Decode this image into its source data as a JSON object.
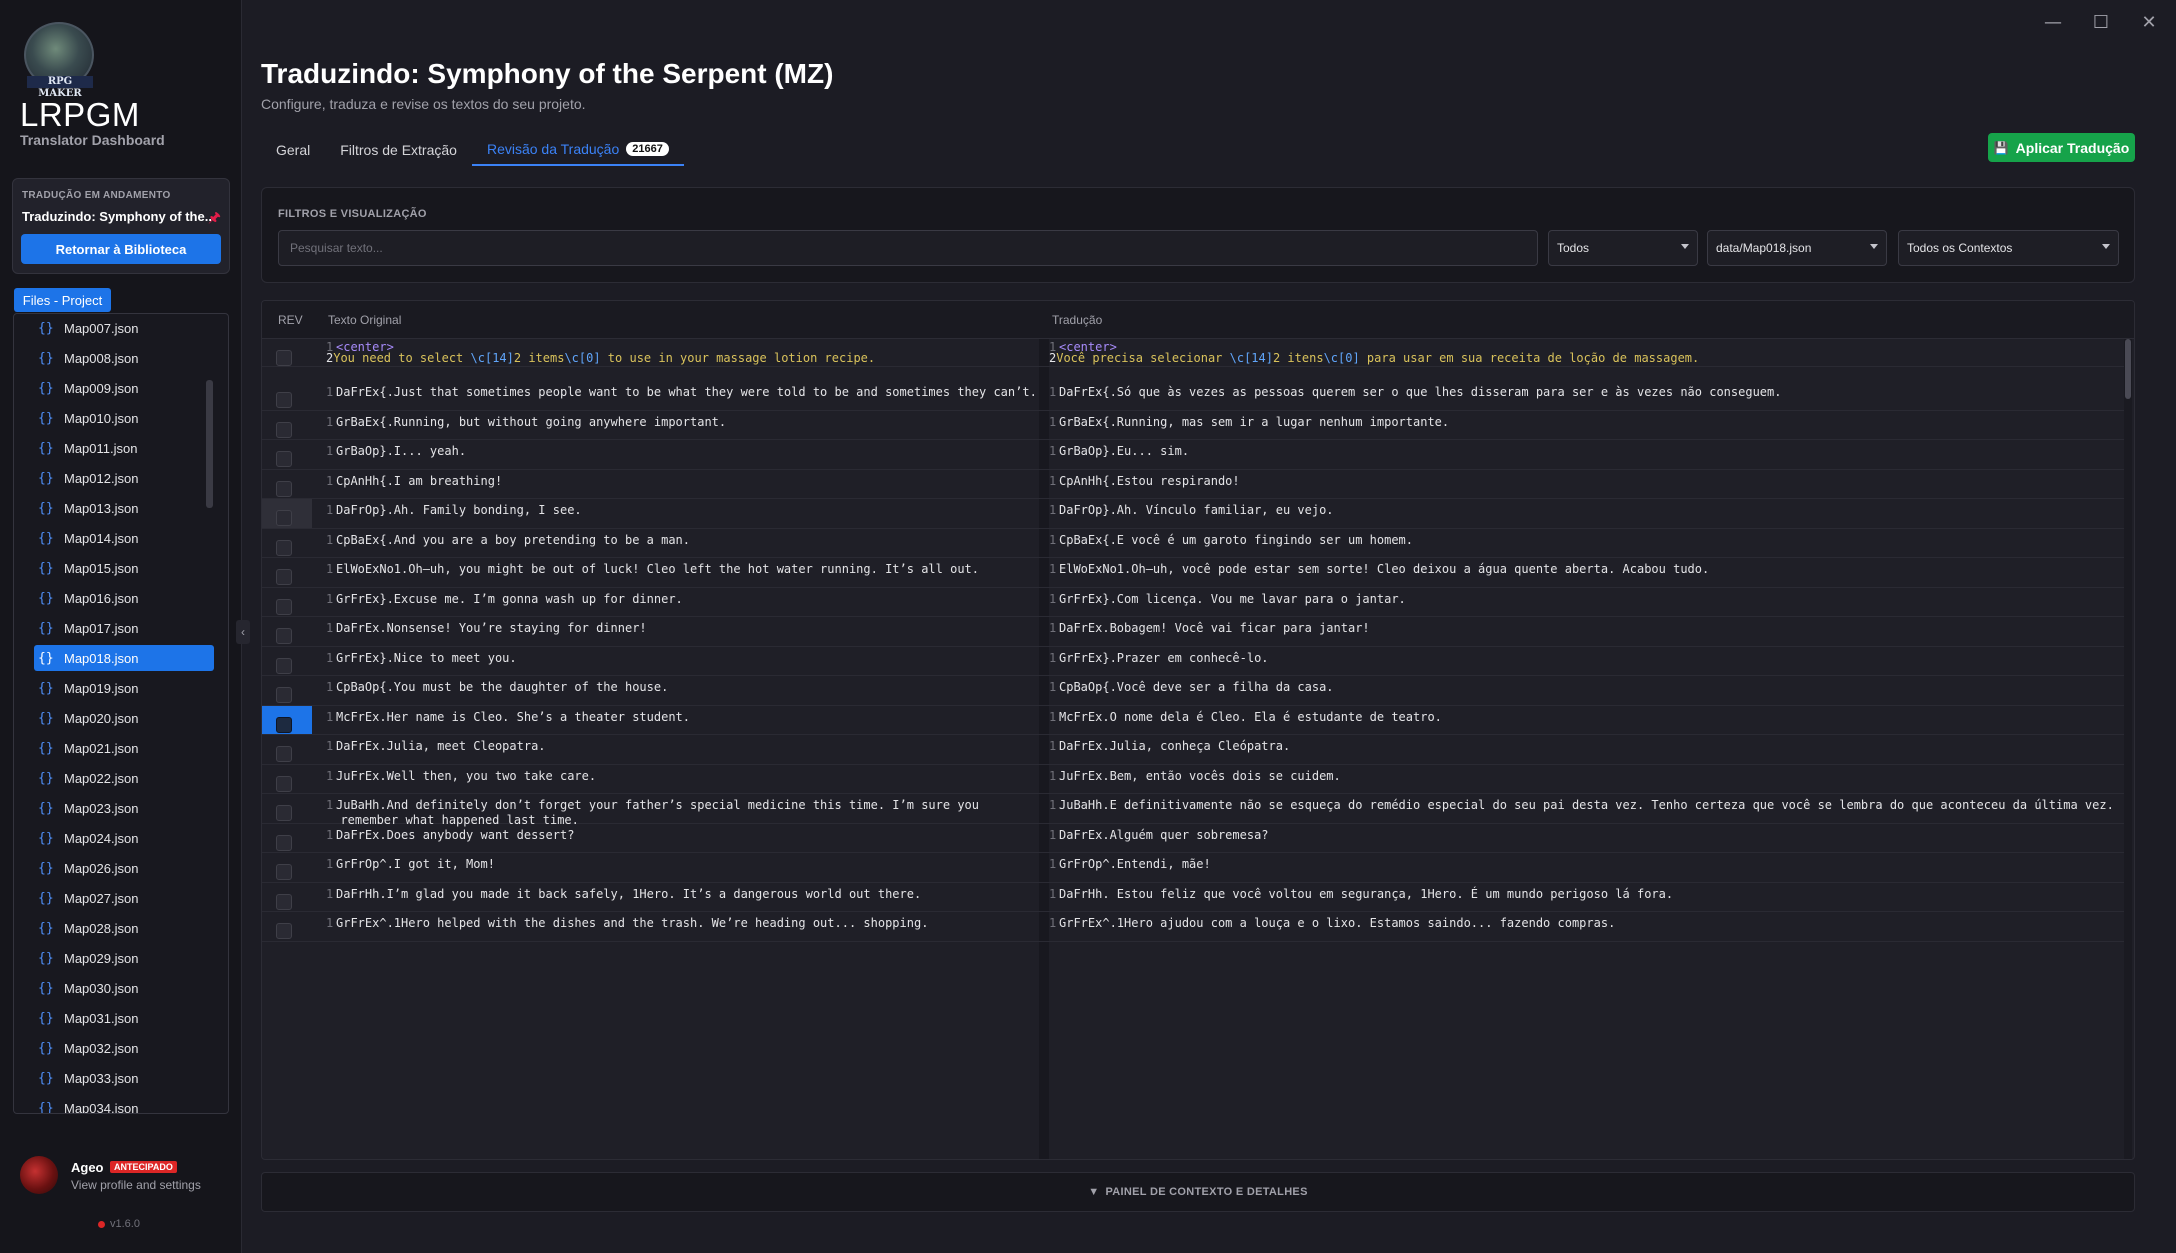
{
  "window": {
    "minimize": "—",
    "maximize": "☐",
    "close": "✕"
  },
  "app": {
    "logo_text": "RPG MAKER",
    "title": "LRPGM",
    "subtitle": "Translator Dashboard"
  },
  "progress": {
    "label": "TRADUÇÃO EM ANDAMENTO",
    "title": "Traduzindo: Symphony of the...",
    "pin": "🖈",
    "back_button": "Retornar à Biblioteca"
  },
  "files": {
    "tab_label": "Files - Project",
    "brace": "{}",
    "items": [
      "Map007.json",
      "Map008.json",
      "Map009.json",
      "Map010.json",
      "Map011.json",
      "Map012.json",
      "Map013.json",
      "Map014.json",
      "Map015.json",
      "Map016.json",
      "Map017.json",
      "Map018.json",
      "Map019.json",
      "Map020.json",
      "Map021.json",
      "Map022.json",
      "Map023.json",
      "Map024.json",
      "Map026.json",
      "Map027.json",
      "Map028.json",
      "Map029.json",
      "Map030.json",
      "Map031.json",
      "Map032.json",
      "Map033.json",
      "Map034.json"
    ],
    "active": "Map018.json",
    "collapse": "‹"
  },
  "user": {
    "name": "Ageo",
    "badge": "ANTECIPADO",
    "sub": "View profile and settings",
    "version": "v1.6.0"
  },
  "main": {
    "title": "Traduzindo: Symphony of the Serpent (MZ)",
    "subtitle": "Configure, traduza e revise os textos do seu projeto.",
    "tabs": [
      {
        "label": "Geral"
      },
      {
        "label": "Filtros de Extração"
      },
      {
        "label": "Revisão da Tradução",
        "count": "21667"
      }
    ],
    "apply_button": "Aplicar Tradução",
    "apply_icon": "💾"
  },
  "filters": {
    "label": "FILTROS E VISUALIZAÇÃO",
    "search_placeholder": "Pesquisar texto...",
    "status": "Todos",
    "file": "data/Map018.json",
    "context": "Todos os Contextos"
  },
  "grid": {
    "headers": {
      "rev": "REV",
      "original": "Texto Original",
      "translation": "Tradução"
    },
    "rows": [
      {
        "o": "You need to select \\c[14]2 items\\c[0] to use in your massage lotion recipe.",
        "t": "Você precisa selecionar \\c[14]2 itens\\c[0] para usar em sua receita de loção de massagem."
      },
      {
        "o": "DaFrEx{.Just that sometimes people want to be what they were told to be and sometimes they can’t.",
        "t": "DaFrEx{.Só que às vezes as pessoas querem ser o que lhes disseram para ser e às vezes não conseguem."
      },
      {
        "o": "GrBaEx{.Running, but without going anywhere important.",
        "t": "GrBaEx{.Running, mas sem ir a lugar nenhum importante."
      },
      {
        "o": "GrBaOp}.I... yeah.",
        "t": "GrBaOp}.Eu... sim."
      },
      {
        "o": "CpAnHh{.I am breathing!",
        "t": "CpAnHh{.Estou respirando!"
      },
      {
        "o": "DaFrOp}.Ah. Family bonding, I see.",
        "t": "DaFrOp}.Ah. Vínculo familiar, eu vejo."
      },
      {
        "o": "CpBaEx{.And you are a boy pretending to be a man.",
        "t": "CpBaEx{.E você é um garoto fingindo ser um homem."
      },
      {
        "o": "ElWoExNo1.Oh—uh, you might be out of luck! Cleo left the hot water running. It’s all out.",
        "t": "ElWoExNo1.Oh—uh, você pode estar sem sorte! Cleo deixou a água quente aberta. Acabou tudo."
      },
      {
        "o": "GrFrEx}.Excuse me. I’m gonna wash up for dinner.",
        "t": "GrFrEx}.Com licença. Vou me lavar para o jantar."
      },
      {
        "o": "DaFrEx.Nonsense! You’re staying for dinner!",
        "t": "DaFrEx.Bobagem! Você vai ficar para jantar!"
      },
      {
        "o": "GrFrEx}.Nice to meet you.",
        "t": "GrFrEx}.Prazer em conhecê-lo."
      },
      {
        "o": "CpBaOp{.You must be the daughter of the house.",
        "t": "CpBaOp{.Você deve ser a filha da casa."
      },
      {
        "o": "McFrEx.Her name is Cleo. She’s a theater student.",
        "t": "McFrEx.O nome dela é Cleo. Ela é estudante de teatro."
      },
      {
        "o": "DaFrEx.Julia, meet Cleopatra.",
        "t": "DaFrEx.Julia, conheça Cleópatra."
      },
      {
        "o": "JuFrEx.Well then, you two take care.",
        "t": "JuFrEx.Bem, então vocês dois se cuidem."
      },
      {
        "o": "JuBaHh.And definitely don’t forget your father’s special medicine this time. I’m sure you",
        "o2": "remember what happened last time.",
        "t": "JuBaHh.E definitivamente não se esqueça do remédio especial do seu pai desta vez. Tenho certeza que você se lembra do que aconteceu da última vez."
      },
      {
        "o": "DaFrEx.Does anybody want dessert?",
        "t": "DaFrEx.Alguém quer sobremesa?"
      },
      {
        "o": "GrFrOp^.I got it, Mom!",
        "t": "GrFrOp^.Entendi, mãe!"
      },
      {
        "o": "DaFrHh.I’m glad you made it back safely, 1Hero. It’s a dangerous world out there.",
        "t": "DaFrHh. Estou feliz que você voltou em segurança, 1Hero. É um mundo perigoso lá fora."
      },
      {
        "o": "GrFrEx^.1Hero helped with the dishes and the trash. We’re heading out... shopping.",
        "t": "GrFrEx^.1Hero ajudou com a louça e o lixo. Estamos saindo... fazendo compras."
      }
    ],
    "first_row": {
      "tag": "<center>",
      "o_parts": [
        "You need to select ",
        "\\c[14]",
        "2 items",
        "\\c[0]",
        " to use in your massage lotion recipe."
      ],
      "t_parts": [
        "Você precisa selecionar ",
        "\\c[14]",
        "2 itens",
        "\\c[0]",
        " para usar em sua receita de loção de massagem."
      ]
    },
    "selected_row": 12,
    "hover_row": 5
  },
  "context_panel": {
    "label": "PAINEL DE CONTEXTO E DETALHES",
    "arrow": "▼"
  }
}
